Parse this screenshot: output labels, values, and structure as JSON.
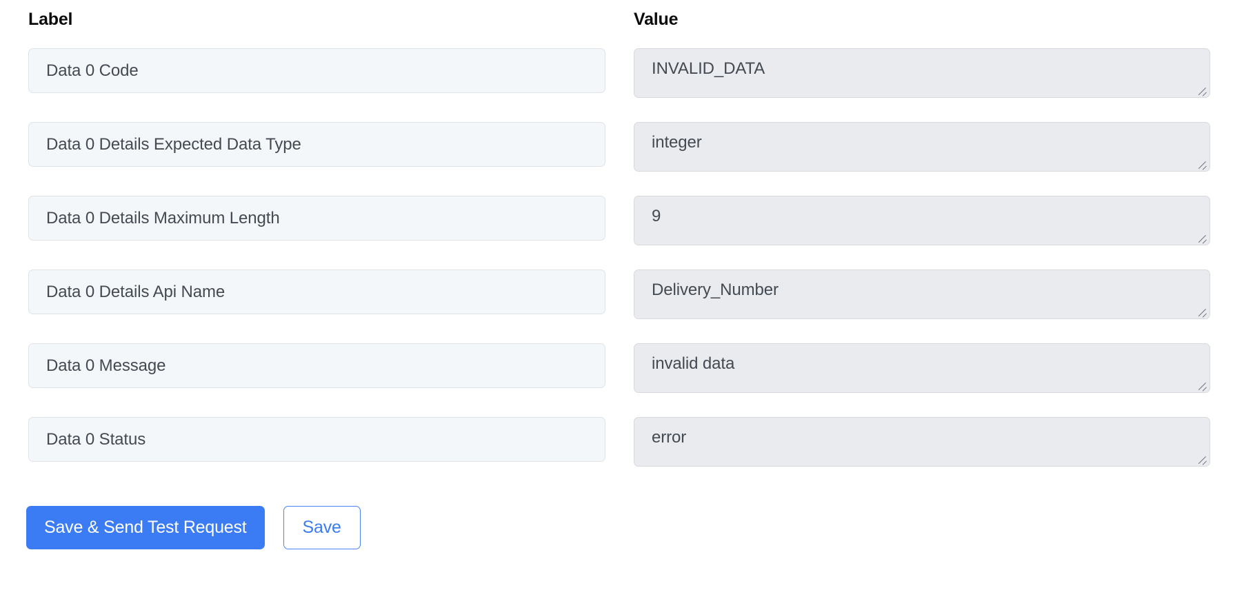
{
  "columns": {
    "label_header": "Label",
    "value_header": "Value"
  },
  "rows": [
    {
      "label": "Data 0 Code",
      "value": "INVALID_DATA"
    },
    {
      "label": "Data 0 Details Expected Data Type",
      "value": "integer"
    },
    {
      "label": "Data 0 Details Maximum Length",
      "value": "9"
    },
    {
      "label": "Data 0 Details Api Name",
      "value": "Delivery_Number"
    },
    {
      "label": "Data 0 Message",
      "value": "invalid data"
    },
    {
      "label": "Data 0 Status",
      "value": "error"
    }
  ],
  "actions": {
    "primary_label": "Save & Send Test Request",
    "secondary_label": "Save"
  },
  "colors": {
    "primary_button_bg": "#3b7cf4",
    "primary_button_text": "#ffffff",
    "secondary_button_text": "#3b7cf4",
    "secondary_button_border": "#4a82f2",
    "label_field_bg": "#f4f7fa",
    "value_field_bg": "#e9ebef",
    "field_text": "#444a52",
    "header_text": "#0b0b0b"
  },
  "icons": {
    "resize_grip": "resize-grip-icon"
  }
}
